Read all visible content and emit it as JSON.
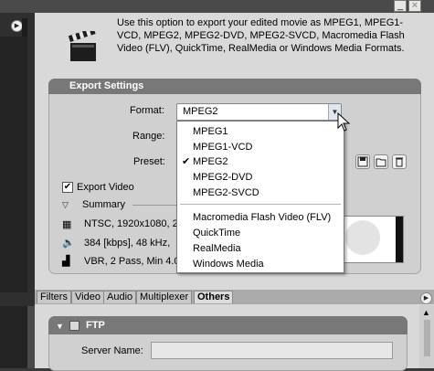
{
  "window": {
    "minimize_glyph": "_",
    "close_glyph": "×"
  },
  "header": {
    "description": "Use this option to export your edited movie as MPEG1, MPEG1-VCD, MPEG2, MPEG2-DVD, MPEG2-SVCD, Macromedia Flash Video (FLV), QuickTime, RealMedia or Windows Media Formats.",
    "icon": "clapperboard-icon"
  },
  "export_settings": {
    "title": "Export Settings",
    "format_label": "Format:",
    "format_value": "MPEG2",
    "range_label": "Range:",
    "preset_label": "Preset:",
    "export_video_label": "Export Video",
    "export_video_checked": true,
    "summary_label": "Summary",
    "summary_video": "NTSC, 1920x1080, 2",
    "summary_audio": "384 [kbps], 48 kHz,",
    "summary_bitrate": "VBR, 2 Pass, Min 4.0"
  },
  "format_dropdown": {
    "options": [
      "MPEG1",
      "MPEG1-VCD",
      "MPEG2",
      "MPEG2-DVD",
      "MPEG2-SVCD",
      "Macromedia Flash Video (FLV)",
      "QuickTime",
      "RealMedia",
      "Windows Media"
    ],
    "selected": "MPEG2",
    "check_glyph": "✔"
  },
  "tabs": {
    "items": [
      "Filters",
      "Video",
      "Audio",
      "Multiplexer",
      "Others"
    ],
    "active": "Others"
  },
  "ftp": {
    "title": "FTP",
    "server_name_label": "Server Name:",
    "server_name_value": ""
  },
  "colors": {
    "panel_bg": "#d9d9d9",
    "title_bar": "#787878",
    "dark_bg": "#2f2f2f"
  }
}
